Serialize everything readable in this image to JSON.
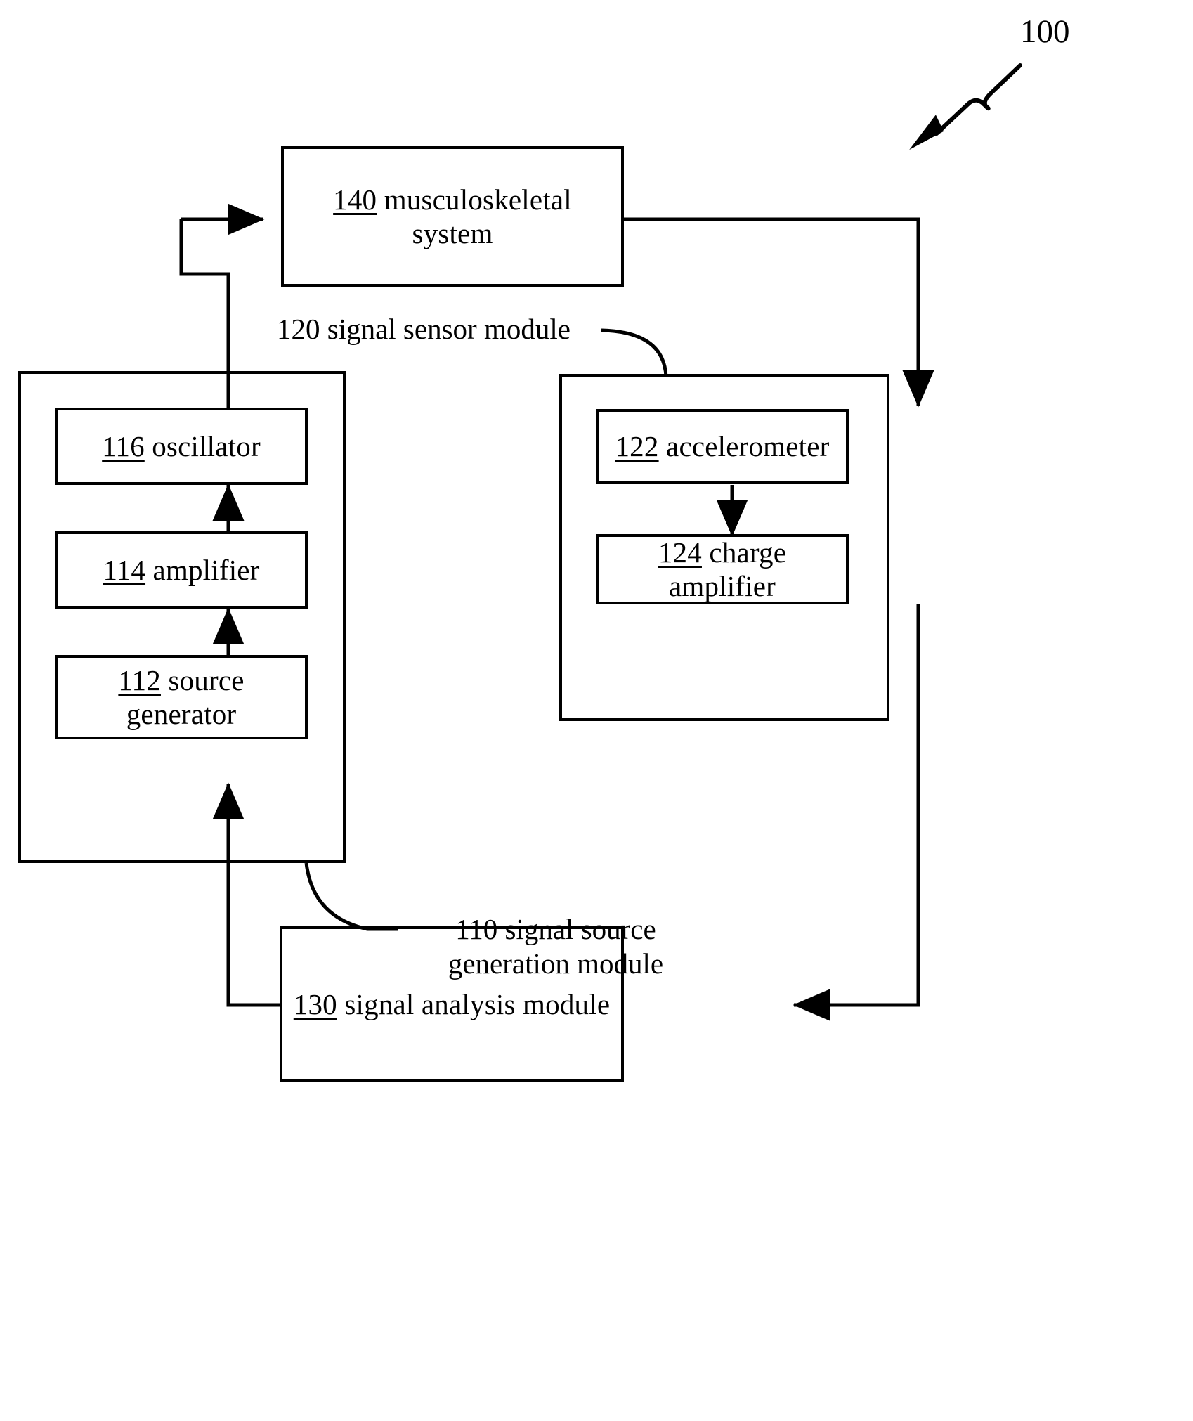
{
  "figure": {
    "number": "100",
    "pointer_icon": "squiggle-arrow-icon"
  },
  "blocks": {
    "musculoskeletal_system": {
      "num": "140",
      "text": " musculoskeletal system"
    },
    "oscillator": {
      "num": "116",
      "text": " oscillator"
    },
    "amplifier": {
      "num": "114",
      "text": " amplifier"
    },
    "source_generator": {
      "num": "112",
      "text": " source generator"
    },
    "accelerometer": {
      "num": "122",
      "text": " accelerometer"
    },
    "charge_amplifier": {
      "num": "124",
      "text": " charge amplifier"
    },
    "signal_analysis_module": {
      "num": "130",
      "text": " signal analysis module"
    }
  },
  "captions": {
    "signal_sensor_module": "120 signal sensor module",
    "signal_source_generation_module": "110 signal source generation module"
  },
  "colors": {
    "line": "#000000",
    "background": "#ffffff",
    "text": "#000000"
  }
}
